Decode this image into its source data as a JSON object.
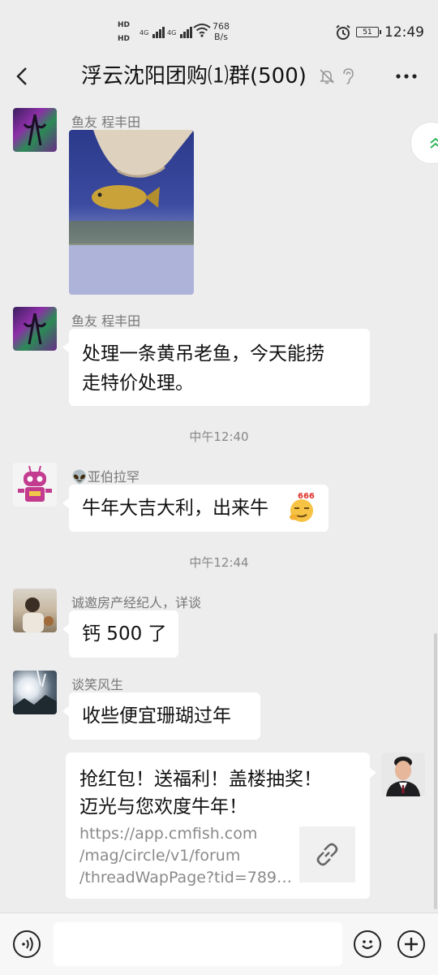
{
  "status_bar": {
    "hd1": "HD",
    "hd2": "HD",
    "net1": "4G",
    "net2": "4G",
    "speed_value": "768",
    "speed_unit": "B/s",
    "battery": "51",
    "time": "12:49"
  },
  "header": {
    "title": "浮云沈阳团购⑴群(500)"
  },
  "messages": [
    {
      "sender": "鱼友 程丰田",
      "type": "image",
      "image": "yellow fish in aquarium"
    },
    {
      "sender": "鱼友 程丰田",
      "type": "text",
      "text_line1": "处理一条黄吊老鱼，今天能捞",
      "text_line2": "走特价处理。"
    },
    {
      "timestamp": "中午12:40"
    },
    {
      "sender_emoji": "👽",
      "sender": "亚伯拉罕",
      "type": "text",
      "text": "牛年大吉大利，出来牛",
      "sticker_label": "666"
    },
    {
      "timestamp": "中午12:44"
    },
    {
      "sender": "诚邀房产经纪人，详谈",
      "type": "text",
      "text": "钙 500 了"
    },
    {
      "sender": "谈笑风生",
      "type": "text",
      "text": "收些便宜珊瑚过年"
    },
    {
      "outgoing": true,
      "type": "link",
      "title_line1": "抢红包！送福利！盖楼抽奖！",
      "title_line2": "迈光与您欢度牛年！",
      "url_line1": "https://app.cmfish.com",
      "url_line2": "/mag/circle/v1/forum",
      "url_line3": "/threadWapPage?tid=789…"
    }
  ],
  "colors": {
    "background": "#ededed",
    "bubble": "#ffffff",
    "meta_text": "#888888",
    "side_button_accent": "#2fb55a"
  },
  "icons": {
    "back": "chevron-left-icon",
    "mute": "bell-off-icon",
    "ear": "ear-icon",
    "more": "ellipsis-icon",
    "voice": "voice-icon",
    "emoji": "smiley-icon",
    "plus": "plus-icon",
    "link": "link-icon",
    "side": "double-chevron-up-icon"
  }
}
